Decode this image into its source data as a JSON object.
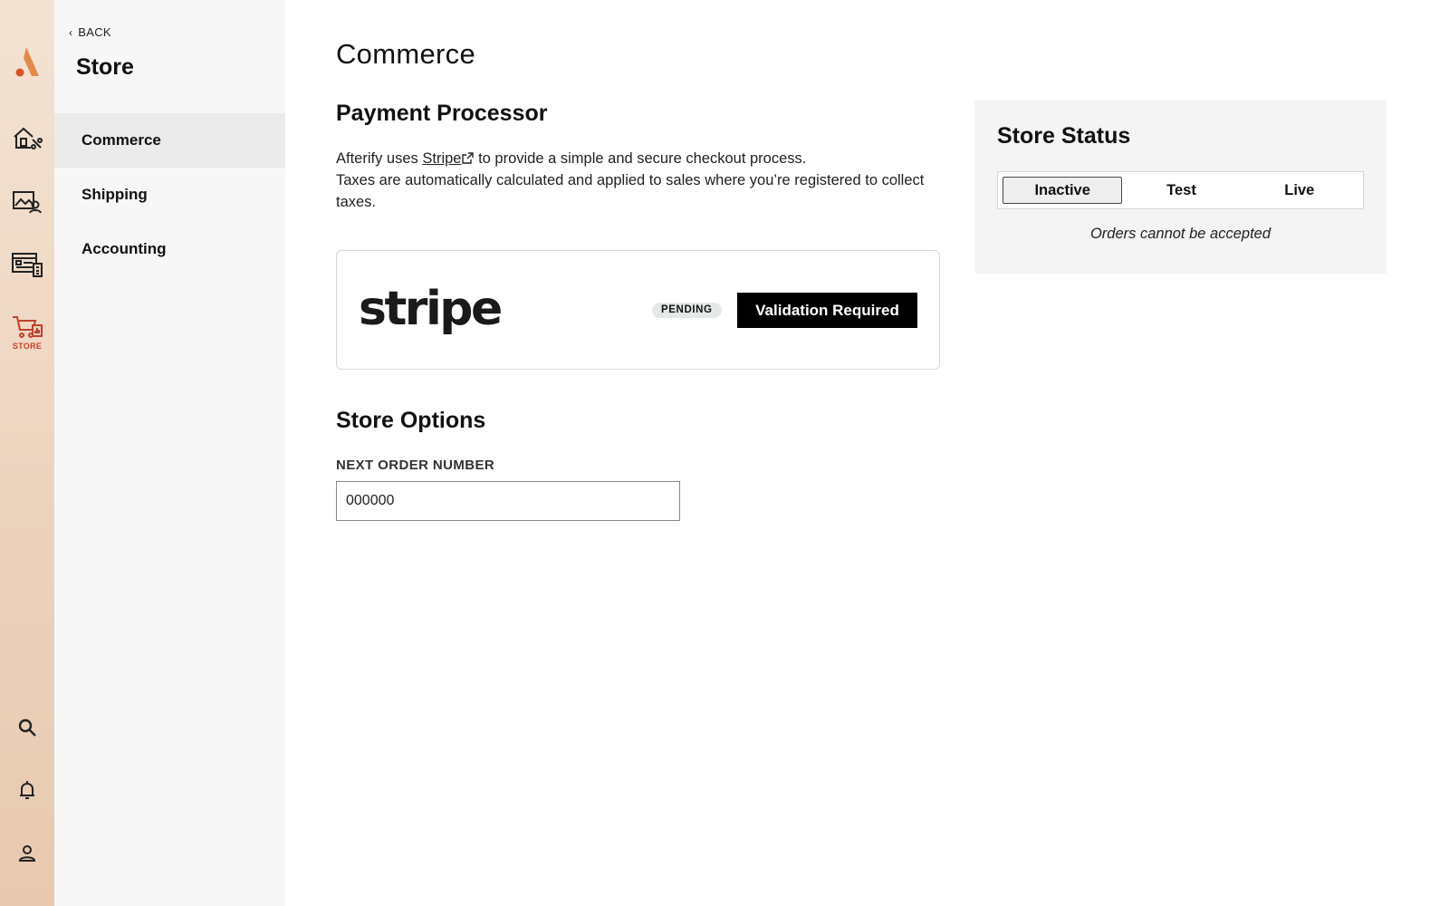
{
  "rail": {
    "store_label": "STORE",
    "brand_color": "#e06a2c",
    "active_color": "#c2412a"
  },
  "subnav": {
    "back_label": "BACK",
    "title": "Store",
    "items": [
      {
        "label": "Commerce",
        "active": true
      },
      {
        "label": "Shipping",
        "active": false
      },
      {
        "label": "Accounting",
        "active": false
      }
    ]
  },
  "main": {
    "page_title": "Commerce",
    "payment": {
      "title": "Payment Processor",
      "desc_prefix": "Afterify uses ",
      "stripe_link": "Stripe",
      "desc_suffix": " to provide a simple and secure checkout process.",
      "desc_line2": "Taxes are automatically calculated and applied to sales where you’re registered to collect taxes.",
      "logo_text": "stripe",
      "badge": "PENDING",
      "action_label": "Validation Required"
    },
    "options": {
      "title": "Store Options",
      "order_label": "NEXT ORDER NUMBER",
      "order_value": "000000"
    },
    "status": {
      "title": "Store Status",
      "options": [
        "Inactive",
        "Test",
        "Live"
      ],
      "selected": "Inactive",
      "note": "Orders cannot be accepted"
    }
  }
}
